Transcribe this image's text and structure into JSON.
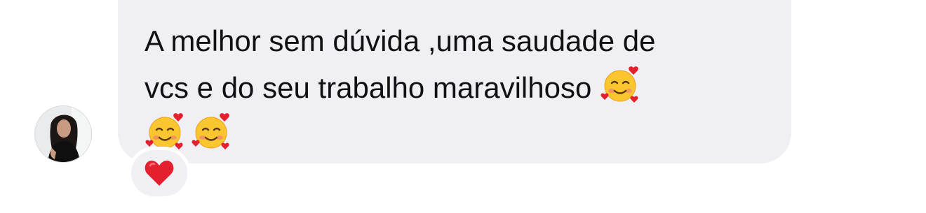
{
  "message": {
    "line1": "A melhor sem dúvida ,uma saudade de",
    "line2": "vcs e do seu trabalho maravilhoso",
    "emoji": "smiling-face-with-hearts"
  },
  "reaction": {
    "emoji": "red-heart"
  },
  "colors": {
    "bubble": "#efeff4",
    "text": "#111111",
    "heart": "#e5202e"
  }
}
